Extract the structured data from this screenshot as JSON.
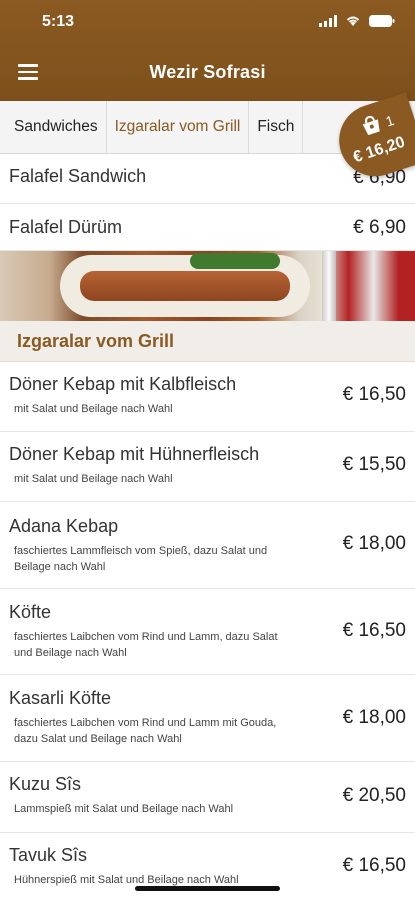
{
  "status": {
    "time": "5:13"
  },
  "header": {
    "title": "Wezir Sofrasi"
  },
  "tabs": [
    {
      "label": "Sandwiches"
    },
    {
      "label": "Izgaralar vom Grill"
    },
    {
      "label": "Fisch"
    }
  ],
  "cart": {
    "count": "1",
    "total": "€ 16,20"
  },
  "sandwich_items": [
    {
      "name": "Falafel Sandwich",
      "price": "€ 6,90"
    },
    {
      "name": "Falafel Dürüm",
      "price": "€ 6,90"
    }
  ],
  "section": {
    "title": "Izgaralar vom Grill"
  },
  "grill_items": [
    {
      "name": "Döner Kebap mit Kalbfleisch",
      "desc": "mit Salat und Beilage nach Wahl",
      "price": "€ 16,50"
    },
    {
      "name": "Döner Kebap mit Hühnerfleisch",
      "desc": "mit Salat und Beilage nach Wahl",
      "price": "€ 15,50"
    },
    {
      "name": "Adana Kebap",
      "desc": "faschiertes Lammfleisch vom Spieß, dazu Salat und Beilage nach Wahl",
      "price": "€ 18,00"
    },
    {
      "name": "Köfte",
      "desc": "faschiertes Laibchen vom Rind und Lamm, dazu Salat und Beilage nach Wahl",
      "price": "€ 16,50"
    },
    {
      "name": "Kasarli Köfte",
      "desc": "faschiertes Laibchen vom Rind und Lamm mit Gouda, dazu Salat und Beilage nach Wahl",
      "price": "€ 18,00"
    },
    {
      "name": "Kuzu Sîs",
      "desc": "Lammspieß mit Salat und Beilage nach Wahl",
      "price": "€ 20,50"
    },
    {
      "name": "Tavuk Sîs",
      "desc": "Hühnerspieß mit Salat und Beilage nach Wahl",
      "price": "€ 16,50"
    }
  ]
}
